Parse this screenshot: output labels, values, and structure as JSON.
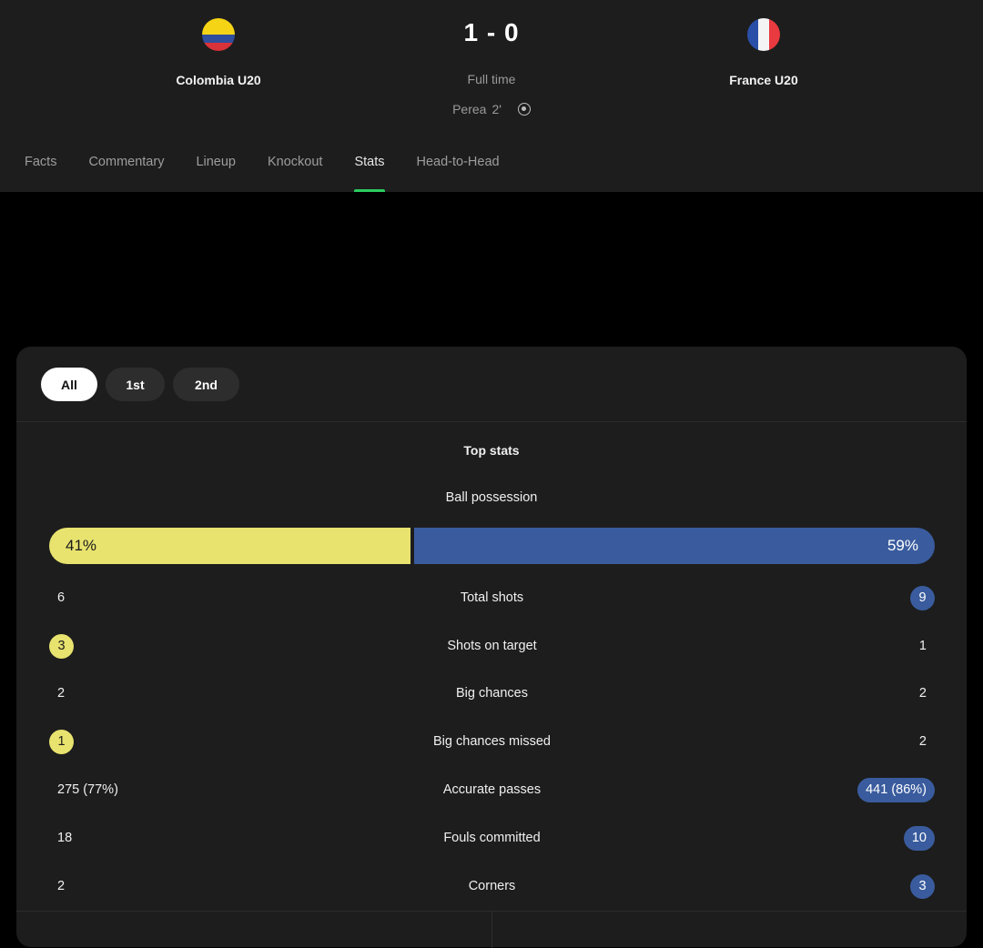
{
  "match": {
    "home_team": "Colombia U20",
    "away_team": "France U20",
    "score": "1 - 0",
    "status": "Full time",
    "scorer_name": "Perea",
    "scorer_minute": "2'"
  },
  "tabs": [
    {
      "label": "Facts"
    },
    {
      "label": "Commentary"
    },
    {
      "label": "Lineup"
    },
    {
      "label": "Knockout"
    },
    {
      "label": "Stats",
      "active": true
    },
    {
      "label": "Head-to-Head"
    }
  ],
  "period_filters": [
    "All",
    "1st",
    "2nd"
  ],
  "section_title": "Top stats",
  "possession": {
    "label": "Ball possession",
    "home": "41%",
    "away": "59%",
    "home_fraction": 0.41
  },
  "stats": [
    {
      "name": "Total shots",
      "home": "6",
      "away": "9",
      "leader": "away"
    },
    {
      "name": "Shots on target",
      "home": "3",
      "away": "1",
      "leader": "home"
    },
    {
      "name": "Big chances",
      "home": "2",
      "away": "2",
      "leader": "none"
    },
    {
      "name": "Big chances missed",
      "home": "1",
      "away": "2",
      "leader": "home"
    },
    {
      "name": "Accurate passes",
      "home": "275 (77%)",
      "away": "441 (86%)",
      "leader": "away"
    },
    {
      "name": "Fouls committed",
      "home": "18",
      "away": "10",
      "leader": "away"
    },
    {
      "name": "Corners",
      "home": "2",
      "away": "3",
      "leader": "away"
    }
  ],
  "colors": {
    "home_accent": "#e8e36e",
    "away_accent": "#3a5c9e",
    "active_tab_indicator": "#2bcc5f"
  }
}
